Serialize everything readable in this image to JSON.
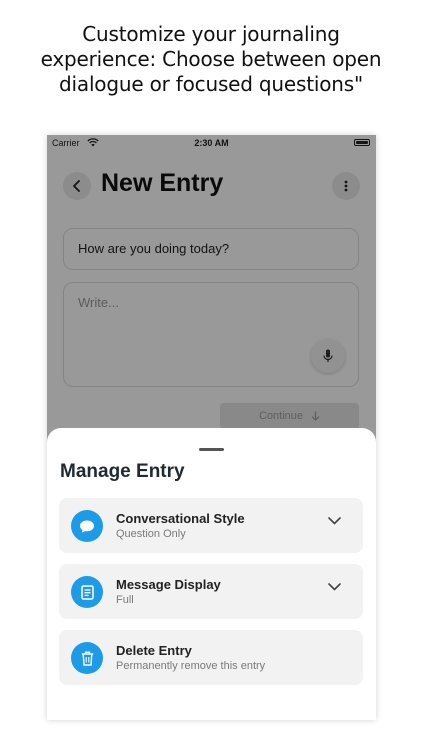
{
  "caption": {
    "line1": "Customize your journaling",
    "line2": "experience: Choose between open",
    "line3": "dialogue or focused questions\""
  },
  "status_bar": {
    "carrier": "Carrier",
    "time": "2:30 AM"
  },
  "entry_screen": {
    "title": "New Entry",
    "prompt": "How are you doing today?",
    "write_placeholder": "Write...",
    "continue_label": "Continue"
  },
  "sheet": {
    "title": "Manage Entry",
    "options": [
      {
        "label": "Conversational Style",
        "sub": "Question Only",
        "icon": "chat-bubble-icon",
        "expandable": true
      },
      {
        "label": "Message Display",
        "sub": "Full",
        "icon": "document-icon",
        "expandable": true
      },
      {
        "label": "Delete Entry",
        "sub": "Permanently remove this entry",
        "icon": "trash-icon",
        "expandable": false
      }
    ]
  },
  "colors": {
    "accent": "#1e9be6",
    "option_bg": "#f2f2f2",
    "overlay": "rgba(0,0,0,0.40)"
  }
}
